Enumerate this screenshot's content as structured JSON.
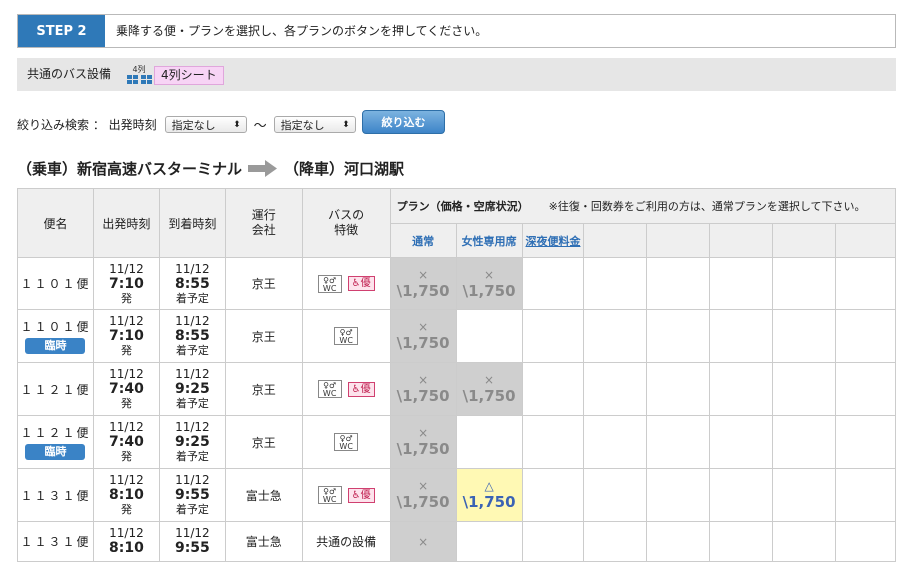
{
  "step": {
    "badge": "STEP 2",
    "text": "乗降する便・プランを選択し、各プランのボタンを押してください。"
  },
  "equipment": {
    "label": "共通のバス設備",
    "icon_text": "4列",
    "seat_label": "4列シート"
  },
  "filter": {
    "label": "絞り込み検索 ： 出発時刻",
    "from_value": "指定なし",
    "tilde": "〜",
    "to_value": "指定なし",
    "button": "絞り込む"
  },
  "route": {
    "from": "（乗車）新宿高速バスターミナル",
    "to": "（降車）河口湖駅"
  },
  "table": {
    "headers": {
      "bin": "便名",
      "dep": "出発時刻",
      "arr": "到着時刻",
      "company": "運行\n会社",
      "features": "バスの\n特徴",
      "plan": "プラン（価格・空席状況）",
      "plan_note": "※往復・回数券をご利用の方は、通常プランを選択して下さい。"
    },
    "plans": [
      "通常",
      "女性専用席",
      "深夜便料金"
    ],
    "rows": [
      {
        "bin": "１１０１便",
        "rinji": "",
        "dep_date": "11/12",
        "dep_time": "7:10",
        "dep_sfx": "発",
        "arr_date": "11/12",
        "arr_time": "8:55",
        "arr_sfx": "着予定",
        "company": "京王",
        "features": [
          "wc-icon",
          "priority-seat-icon"
        ],
        "cells": [
          {
            "mark": "×",
            "price": "\\1,750",
            "state": "soldout"
          },
          {
            "mark": "×",
            "price": "\\1,750",
            "state": "soldout"
          },
          null
        ]
      },
      {
        "bin": "１１０１便",
        "rinji": "臨時",
        "dep_date": "11/12",
        "dep_time": "7:10",
        "dep_sfx": "発",
        "arr_date": "11/12",
        "arr_time": "8:55",
        "arr_sfx": "着予定",
        "company": "京王",
        "features": [
          "wc-icon"
        ],
        "cells": [
          {
            "mark": "×",
            "price": "\\1,750",
            "state": "soldout"
          },
          null,
          null
        ]
      },
      {
        "bin": "１１２１便",
        "rinji": "",
        "dep_date": "11/12",
        "dep_time": "7:40",
        "dep_sfx": "発",
        "arr_date": "11/12",
        "arr_time": "9:25",
        "arr_sfx": "着予定",
        "company": "京王",
        "features": [
          "wc-icon",
          "priority-seat-icon"
        ],
        "cells": [
          {
            "mark": "×",
            "price": "\\1,750",
            "state": "soldout"
          },
          {
            "mark": "×",
            "price": "\\1,750",
            "state": "soldout"
          },
          null
        ]
      },
      {
        "bin": "１１２１便",
        "rinji": "臨時",
        "dep_date": "11/12",
        "dep_time": "7:40",
        "dep_sfx": "発",
        "arr_date": "11/12",
        "arr_time": "9:25",
        "arr_sfx": "着予定",
        "company": "京王",
        "features": [
          "wc-icon"
        ],
        "cells": [
          {
            "mark": "×",
            "price": "\\1,750",
            "state": "soldout"
          },
          null,
          null
        ]
      },
      {
        "bin": "１１３１便",
        "rinji": "",
        "dep_date": "11/12",
        "dep_time": "8:10",
        "dep_sfx": "発",
        "arr_date": "11/12",
        "arr_time": "9:55",
        "arr_sfx": "着予定",
        "company": "富士急",
        "features": [
          "wc-icon",
          "priority-seat-icon"
        ],
        "cells": [
          {
            "mark": "×",
            "price": "\\1,750",
            "state": "soldout"
          },
          {
            "mark": "△",
            "price": "\\1,750",
            "state": "available"
          },
          null
        ]
      },
      {
        "bin": "１１３１便",
        "rinji": "",
        "dep_date": "11/12",
        "dep_time": "8:10",
        "dep_sfx": "",
        "arr_date": "11/12",
        "arr_time": "9:55",
        "arr_sfx": "",
        "company": "富士急",
        "features_text": "共通の設備",
        "features": [],
        "cells": [
          {
            "mark": "×",
            "price": "",
            "state": "soldout"
          },
          null,
          null
        ]
      }
    ]
  },
  "icons": {
    "wc_top": "♀♂",
    "wc_bottom": "WC",
    "priority": "優"
  },
  "colors": {
    "accent": "#2f79b8",
    "soldout": "#cfcfcf",
    "available": "#fff9b4",
    "plan_link": "#2f6fb5",
    "seat_badge": "#f7d4f5"
  }
}
